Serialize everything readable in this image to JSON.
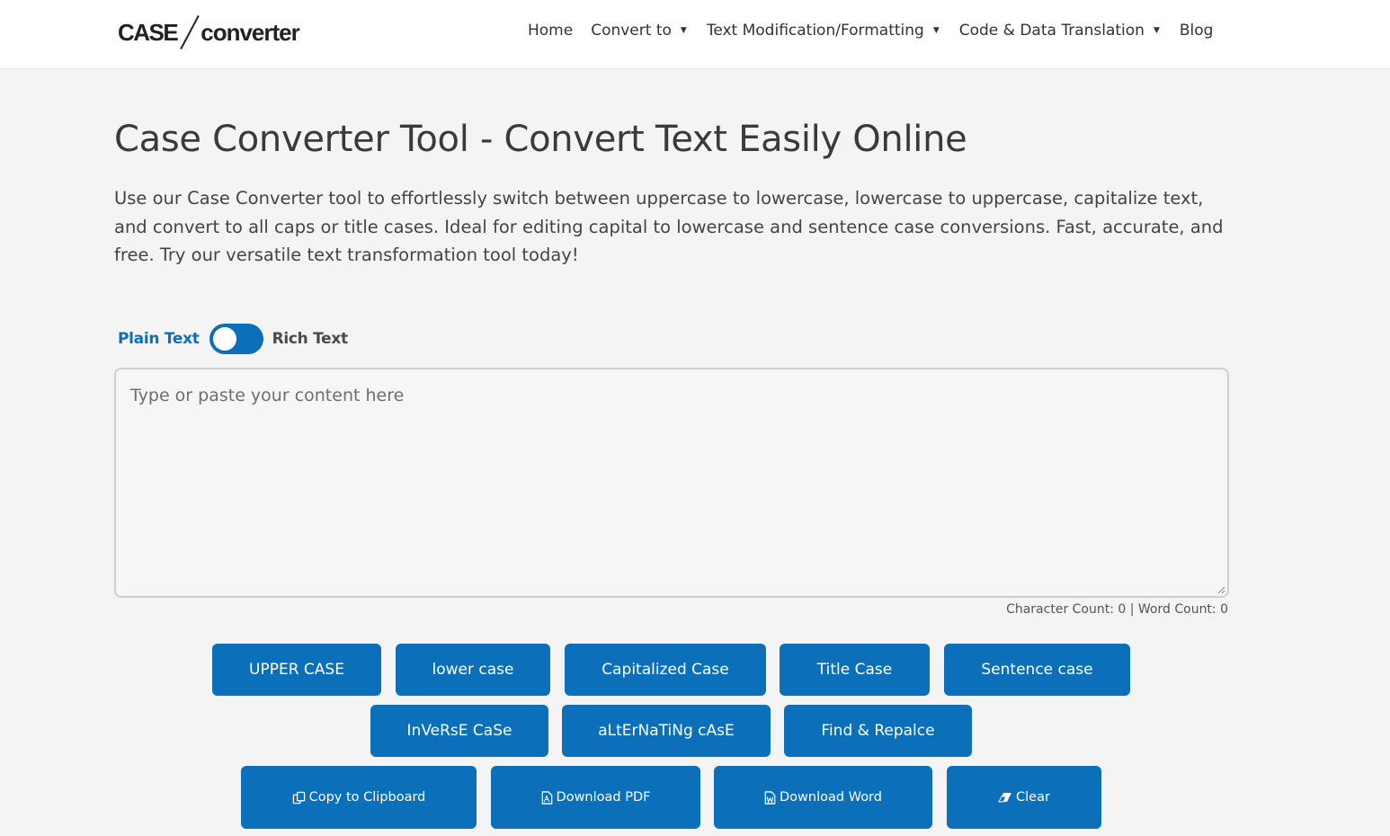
{
  "header": {
    "logo": {
      "case": "CASE",
      "converter": "converter"
    },
    "nav": [
      {
        "label": "Home",
        "dropdown": false
      },
      {
        "label": "Convert to",
        "dropdown": true
      },
      {
        "label": "Text Modification/Formatting",
        "dropdown": true
      },
      {
        "label": "Code & Data Translation",
        "dropdown": true
      },
      {
        "label": "Blog",
        "dropdown": false
      }
    ],
    "caret": "▼"
  },
  "main": {
    "title": "Case Converter Tool - Convert Text Easily Online",
    "description": "Use our Case Converter tool to effortlessly switch between uppercase to lowercase, lowercase to uppercase, capitalize text, and convert to all caps or title cases. Ideal for editing capital to lowercase and sentence case conversions. Fast, accurate, and free. Try our versatile text transformation tool today!"
  },
  "editor": {
    "toggle": {
      "left_label": "Plain Text",
      "right_label": "Rich Text",
      "mode": "Plain Text"
    },
    "value": "",
    "placeholder": "Type or paste your content here",
    "counts": "Character Count: 0 | Word Count: 0"
  },
  "buttons": {
    "row1": [
      "UPPER CASE",
      "lower case",
      "Capitalized Case",
      "Title Case",
      "Sentence case"
    ],
    "row2": [
      "InVeRsE CaSe",
      "aLtErNaTiNg cAsE",
      "Find & Repalce"
    ],
    "row3": [
      {
        "label": "Copy to Clipboard",
        "icon": "copy-icon"
      },
      {
        "label": "Download PDF",
        "icon": "pdf-file-icon"
      },
      {
        "label": "Download Word",
        "icon": "word-file-icon"
      },
      {
        "label": "Clear",
        "icon": "eraser-icon"
      }
    ]
  },
  "colors": {
    "accent": "#0b6fba",
    "background": "#f4f4f4",
    "header_bg": "#ffffff"
  }
}
